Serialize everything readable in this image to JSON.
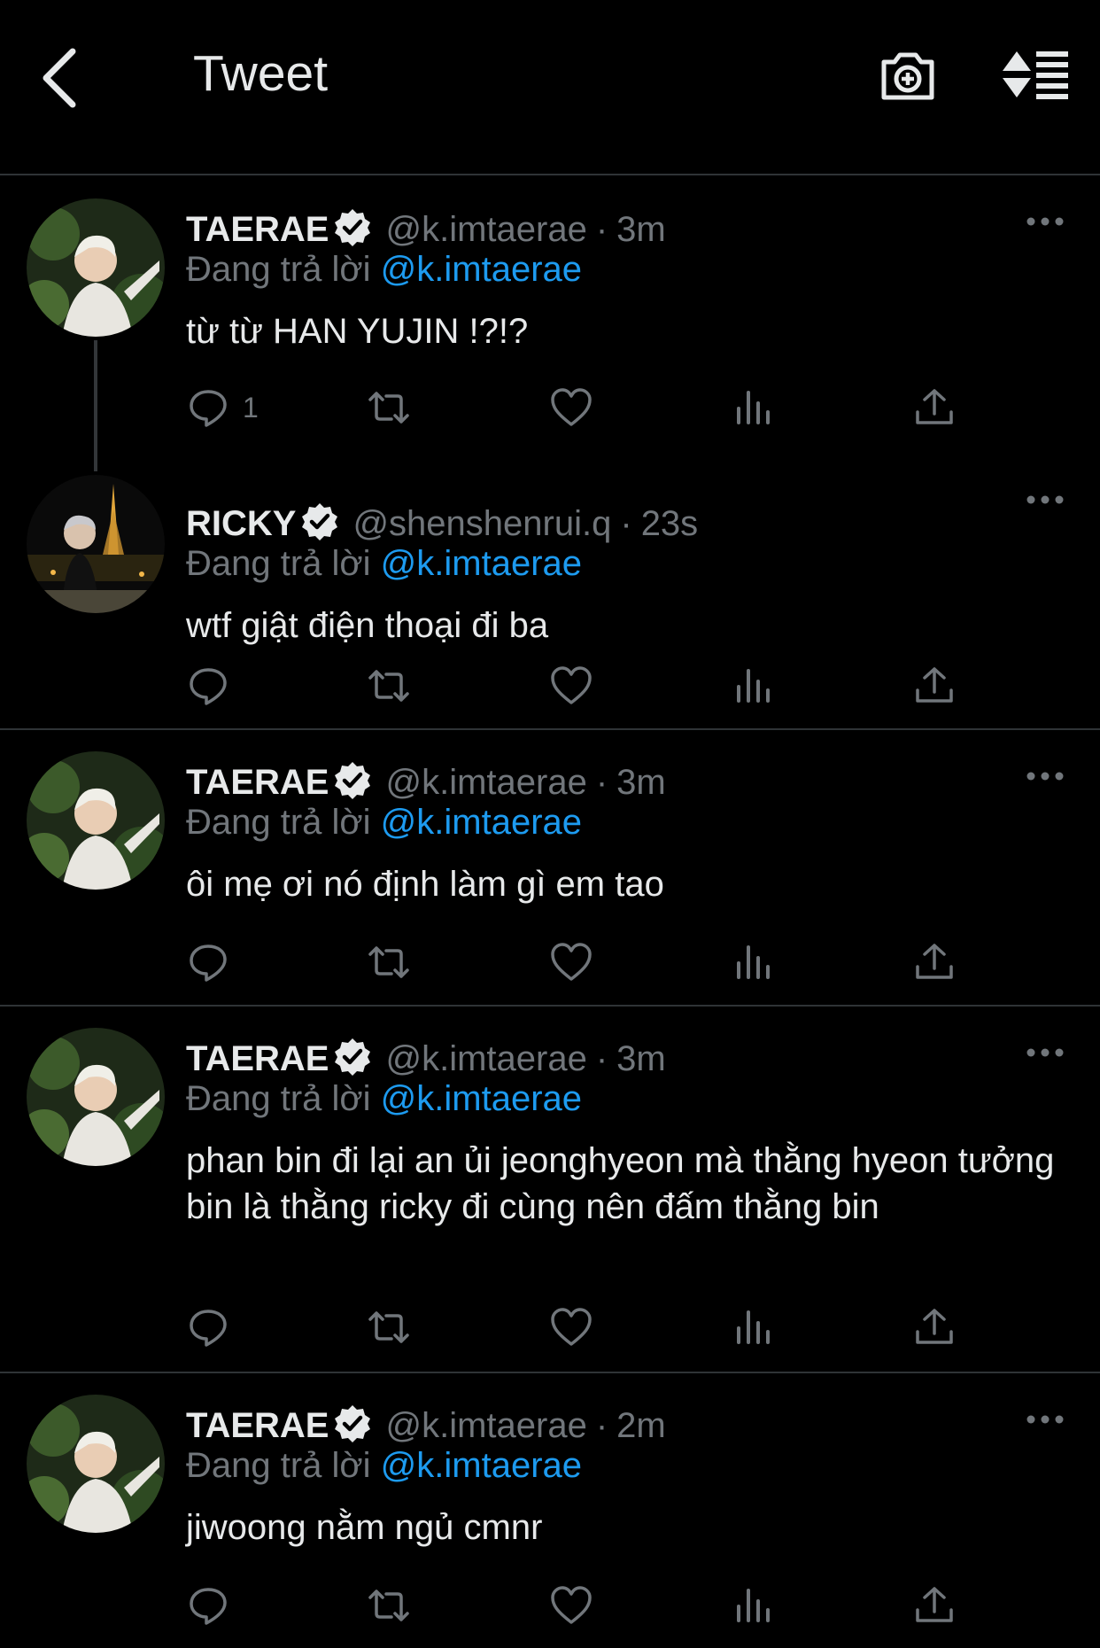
{
  "header": {
    "title": "Tweet",
    "icons": [
      "back-icon",
      "camera-plus-icon",
      "sort-icon"
    ]
  },
  "colors": {
    "background": "#000000",
    "text": "#e7e9ea",
    "muted": "#71767b",
    "link": "#1d9bf0",
    "separator": "#2f3336"
  },
  "replying_prefix": "Đang trả lời",
  "tweets": [
    {
      "name": "TAERAE",
      "handle": "@k.imtaerae",
      "time": "3m",
      "reply_to": "@k.imtaerae",
      "text": "từ từ HAN YUJIN !?!?",
      "reply_count": "1"
    },
    {
      "name": "RICKY",
      "handle": "@shenshenrui.q",
      "time": "23s",
      "reply_to": "@k.imtaerae",
      "text": "wtf giật điện thoại đi ba",
      "reply_count": ""
    },
    {
      "name": "TAERAE",
      "handle": "@k.imtaerae",
      "time": "3m",
      "reply_to": "@k.imtaerae",
      "text": "ôi mẹ ơi nó định làm gì em tao",
      "reply_count": ""
    },
    {
      "name": "TAERAE",
      "handle": "@k.imtaerae",
      "time": "3m",
      "reply_to": "@k.imtaerae",
      "text": "phan bin đi lại an ủi jeonghyeon mà thằng hyeon tưởng bin là thằng ricky đi cùng nên đấm thằng bin",
      "reply_count": ""
    },
    {
      "name": "TAERAE",
      "handle": "@k.imtaerae",
      "time": "2m",
      "reply_to": "@k.imtaerae",
      "text": "jiwoong nằm ngủ cmnr",
      "reply_count": ""
    }
  ]
}
